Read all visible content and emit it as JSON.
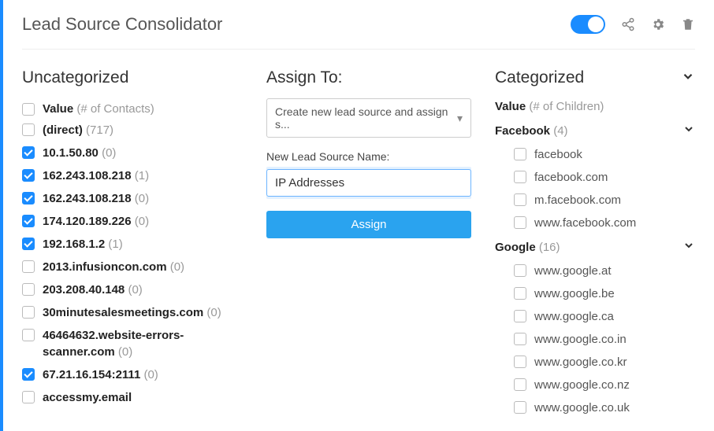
{
  "header": {
    "title": "Lead Source Consolidator"
  },
  "uncategorized": {
    "title": "Uncategorized",
    "value_label": "Value",
    "count_label": "(# of Contacts)",
    "items": [
      {
        "label": "(direct)",
        "count": "(717)",
        "checked": false
      },
      {
        "label": "10.1.50.80",
        "count": "(0)",
        "checked": true
      },
      {
        "label": "162.243.108.218",
        "count": "(1)",
        "checked": true
      },
      {
        "label": "162.243.108.218",
        "count": "(0)",
        "checked": true
      },
      {
        "label": "174.120.189.226",
        "count": "(0)",
        "checked": true
      },
      {
        "label": "192.168.1.2",
        "count": "(1)",
        "checked": true
      },
      {
        "label": "2013.infusioncon.com",
        "count": "(0)",
        "checked": false
      },
      {
        "label": "203.208.40.148",
        "count": "(0)",
        "checked": false
      },
      {
        "label": "30minutesalesmeetings.com",
        "count": "(0)",
        "checked": false
      },
      {
        "label": "46464632.website-errors-scanner.com",
        "count": "(0)",
        "checked": false
      },
      {
        "label": "67.21.16.154:2111",
        "count": "(0)",
        "checked": true
      },
      {
        "label": "accessmy.email",
        "count": "",
        "checked": false
      }
    ]
  },
  "assign": {
    "title": "Assign To:",
    "select_value": "Create new lead source and assign s...",
    "new_label": "New Lead Source Name:",
    "input_value": "IP Addresses",
    "button_label": "Assign"
  },
  "categorized": {
    "title": "Categorized",
    "value_label": "Value",
    "count_label": "(# of Children)",
    "groups": [
      {
        "name": "Facebook",
        "count": "(4)",
        "items": [
          "facebook",
          "facebook.com",
          "m.facebook.com",
          "www.facebook.com"
        ]
      },
      {
        "name": "Google",
        "count": "(16)",
        "items": [
          "www.google.at",
          "www.google.be",
          "www.google.ca",
          "www.google.co.in",
          "www.google.co.kr",
          "www.google.co.nz",
          "www.google.co.uk"
        ]
      }
    ]
  }
}
